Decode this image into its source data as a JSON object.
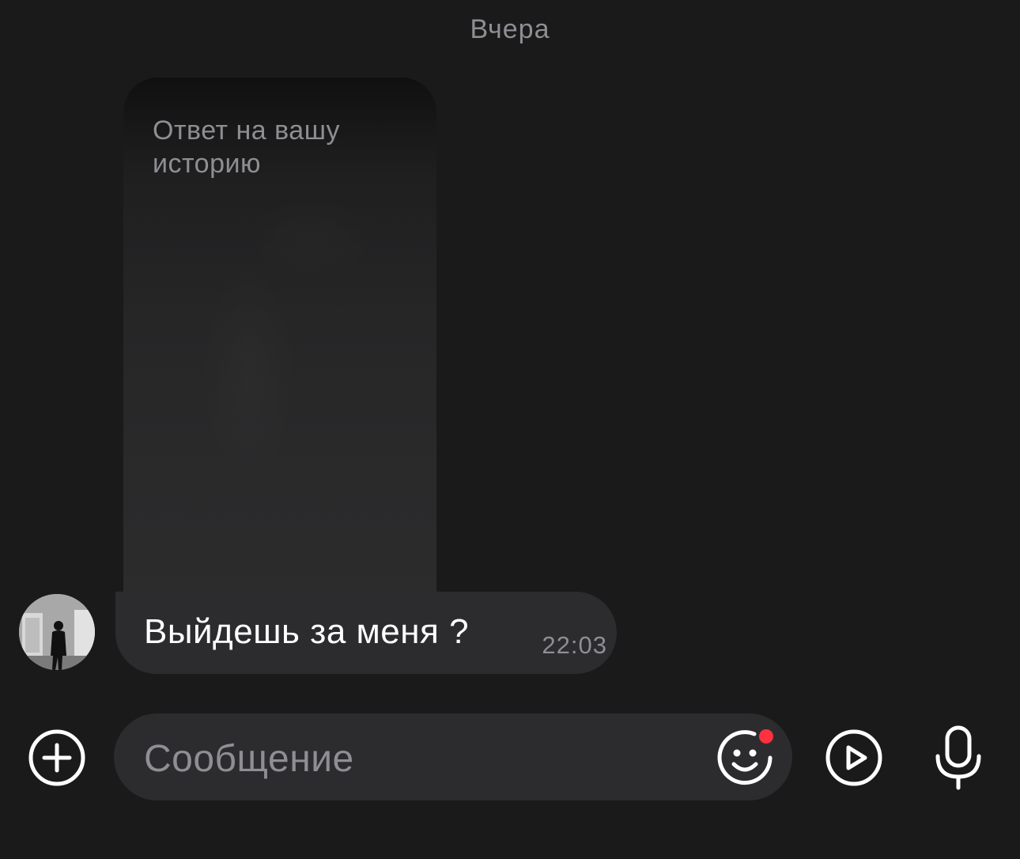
{
  "date_separator": "Вчера",
  "story_reply": {
    "label": "Ответ на вашу историю"
  },
  "message": {
    "text": "Выйдешь за меня ?",
    "time": "22:03"
  },
  "composer": {
    "placeholder": "Сообщение"
  },
  "icons": {
    "add": "plus-circle-icon",
    "sticker": "smiley-sticker-icon",
    "video": "play-circle-icon",
    "mic": "microphone-icon"
  },
  "colors": {
    "background": "#1a1a1b",
    "bubble": "#2c2c2e",
    "muted_text": "#8e8e93",
    "notification_dot": "#ff3040"
  }
}
